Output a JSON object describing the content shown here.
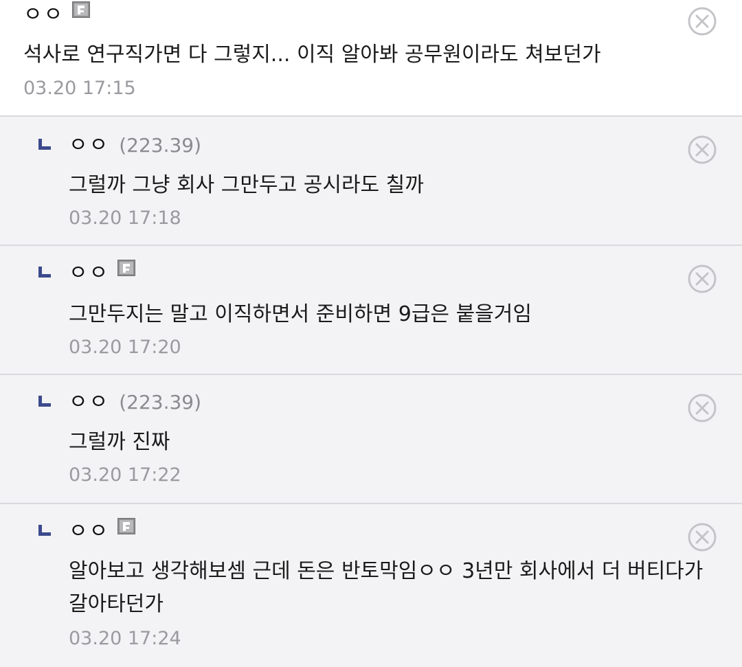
{
  "comments": [
    {
      "nick": "ㅇㅇ",
      "ip": "",
      "fixed": true,
      "text": "석사로 연구직가면 다 그렇지... 이직 알아봐 공무원이라도 쳐보던가",
      "time": "03.20 17:15",
      "reply": false
    },
    {
      "nick": "ㅇㅇ",
      "ip": "(223.39)",
      "fixed": false,
      "text": "그럴까 그냥 회사 그만두고 공시라도 칠까",
      "time": "03.20 17:18",
      "reply": true
    },
    {
      "nick": "ㅇㅇ",
      "ip": "",
      "fixed": true,
      "text": "그만두지는 말고 이직하면서 준비하면 9급은 붙을거임",
      "time": "03.20 17:20",
      "reply": true
    },
    {
      "nick": "ㅇㅇ",
      "ip": "(223.39)",
      "fixed": false,
      "text": "그럴까 진짜",
      "time": "03.20 17:22",
      "reply": true
    },
    {
      "nick": "ㅇㅇ",
      "ip": "",
      "fixed": true,
      "text": "알아보고 생각해보셈 근데 돈은 반토막임ㅇㅇ 3년만 회사에서 더 버티다가 갈아타던가",
      "time": "03.20 17:24",
      "reply": true
    }
  ],
  "icons": {
    "reply_marker": "reply-arrow-icon",
    "fixed_user": "fixed-nick-icon",
    "delete": "delete-x-icon"
  },
  "colors": {
    "reply_marker": "#3c4a8c",
    "reply_bg": "#f3f3f5",
    "divider": "#d9d9de",
    "timestamp": "#9a9a9f",
    "delete_icon": "#c4c4c8"
  }
}
